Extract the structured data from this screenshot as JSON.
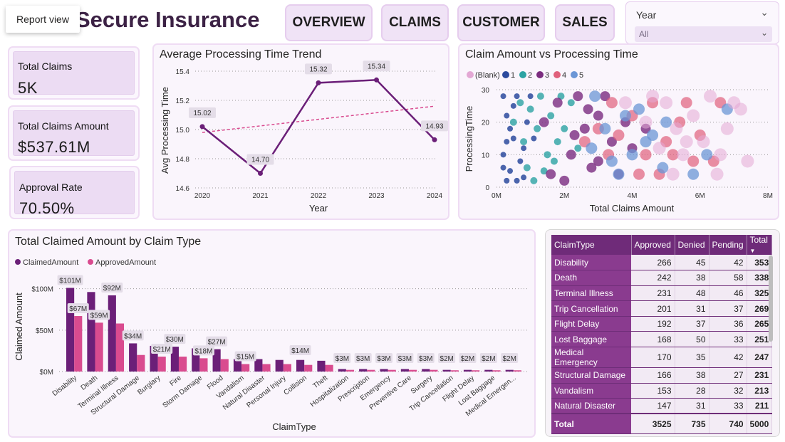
{
  "tooltip": "Report view",
  "title": "Secure Insurance",
  "nav": [
    "OVERVIEW",
    "CLAIMS",
    "CUSTOMER",
    "SALES"
  ],
  "slicer": {
    "label": "Year",
    "value": "All"
  },
  "kpis": [
    {
      "label": "Total Claims",
      "value": "5K"
    },
    {
      "label": "Total Claims Amount",
      "value": "$537.61M"
    },
    {
      "label": "Approval Rate",
      "value": "70.50%"
    }
  ],
  "colors": {
    "purple": "#6b1f78",
    "pink": "#d94b8f",
    "trend": "#d94b8f"
  },
  "line_chart": {
    "title": "Average Processing Time Trend",
    "xlabel": "Year",
    "ylabel": "Avg Processing Time",
    "chart_data": {
      "type": "line",
      "x": [
        "2020",
        "2021",
        "2022",
        "2023",
        "2024"
      ],
      "values": [
        15.02,
        14.7,
        15.32,
        15.34,
        14.93
      ],
      "labels": [
        "15.02",
        "14.70",
        "15.32",
        "15.34",
        "14.93"
      ],
      "ylim": [
        14.6,
        15.4
      ],
      "yticks": [
        "15.4",
        "15.2",
        "15.0",
        "14.8",
        "14.6"
      ],
      "trendline": [
        14.98,
        15.16
      ]
    }
  },
  "scatter_chart": {
    "title": "Claim Amount vs Processing Time",
    "xlabel": "Total Claims Amount",
    "ylabel": "ProcessingTime",
    "legend": [
      {
        "name": "(Blank)",
        "color": "#e3a8d4"
      },
      {
        "name": "1",
        "color": "#2c4a9e"
      },
      {
        "name": "2",
        "color": "#2ca3a3"
      },
      {
        "name": "3",
        "color": "#7b2c7f"
      },
      {
        "name": "4",
        "color": "#e0607c"
      },
      {
        "name": "5",
        "color": "#6b96d6"
      }
    ],
    "xticks": [
      "0M",
      "2M",
      "4M",
      "6M",
      "8M"
    ],
    "yticks": [
      "30",
      "20",
      "10",
      "0"
    ],
    "chart_data": {
      "type": "scatter",
      "xlim": [
        0,
        8
      ],
      "ylim": [
        0,
        30
      ],
      "points": [
        [
          0.2,
          28,
          1
        ],
        [
          0.3,
          22,
          1
        ],
        [
          0.2,
          10,
          1
        ],
        [
          0.4,
          5,
          1
        ],
        [
          0.5,
          15,
          1
        ],
        [
          0.6,
          28,
          1
        ],
        [
          0.4,
          18,
          1
        ],
        [
          0.3,
          2,
          1
        ],
        [
          0.8,
          12,
          1
        ],
        [
          0.5,
          25,
          1
        ],
        [
          0.7,
          8,
          1
        ],
        [
          0.9,
          20,
          1
        ],
        [
          0.3,
          14,
          1
        ],
        [
          0.6,
          2,
          1
        ],
        [
          1.0,
          28,
          1
        ],
        [
          0.2,
          6,
          1
        ],
        [
          1.1,
          15,
          1
        ],
        [
          0.8,
          3,
          1
        ],
        [
          0.5,
          20,
          2
        ],
        [
          0.8,
          14,
          2
        ],
        [
          1.0,
          24,
          2
        ],
        [
          1.2,
          18,
          2
        ],
        [
          1.5,
          10,
          2
        ],
        [
          0.9,
          6,
          2
        ],
        [
          1.3,
          28,
          2
        ],
        [
          1.6,
          22,
          2
        ],
        [
          1.8,
          14,
          2
        ],
        [
          0.7,
          26,
          2
        ],
        [
          2.0,
          18,
          2
        ],
        [
          1.4,
          5,
          2
        ],
        [
          2.2,
          26,
          2
        ],
        [
          1.1,
          2,
          2
        ],
        [
          1.7,
          8,
          2
        ],
        [
          2.4,
          12,
          2
        ],
        [
          1.9,
          28,
          2
        ],
        [
          1.4,
          20,
          3
        ],
        [
          1.8,
          26,
          3
        ],
        [
          2.2,
          10,
          3
        ],
        [
          2.6,
          18,
          3
        ],
        [
          3.0,
          22,
          3
        ],
        [
          2.8,
          6,
          3
        ],
        [
          3.4,
          14,
          3
        ],
        [
          2.4,
          28,
          3
        ],
        [
          1.6,
          4,
          3
        ],
        [
          3.2,
          28,
          3
        ],
        [
          3.6,
          4,
          3
        ],
        [
          2.0,
          2,
          3
        ],
        [
          3.0,
          8,
          3
        ],
        [
          2.7,
          24,
          3
        ],
        [
          4.0,
          12,
          3
        ],
        [
          3.8,
          20,
          3
        ],
        [
          4.4,
          18,
          3
        ],
        [
          2.3,
          16,
          3
        ],
        [
          2.6,
          14,
          4
        ],
        [
          3.0,
          18,
          4
        ],
        [
          3.4,
          26,
          4
        ],
        [
          3.6,
          16,
          4
        ],
        [
          4.0,
          22,
          4
        ],
        [
          4.4,
          10,
          4
        ],
        [
          4.6,
          26,
          4
        ],
        [
          5.0,
          14,
          4
        ],
        [
          5.4,
          20,
          4
        ],
        [
          5.8,
          8,
          4
        ],
        [
          6.0,
          16,
          4
        ],
        [
          4.2,
          4,
          4
        ],
        [
          4.8,
          4,
          4
        ],
        [
          5.6,
          26,
          4
        ],
        [
          6.4,
          8,
          4
        ],
        [
          6.6,
          26,
          4
        ],
        [
          3.3,
          10,
          4
        ],
        [
          5.2,
          10,
          4
        ],
        [
          2.8,
          12,
          5
        ],
        [
          3.2,
          18,
          5
        ],
        [
          3.6,
          4,
          5
        ],
        [
          3.8,
          22,
          5
        ],
        [
          4.0,
          10,
          5
        ],
        [
          4.2,
          24,
          5
        ],
        [
          4.6,
          16,
          5
        ],
        [
          4.9,
          6,
          5
        ],
        [
          5.0,
          20,
          5
        ],
        [
          6.2,
          10,
          5
        ],
        [
          6.8,
          24,
          5
        ],
        [
          3.4,
          8,
          5
        ],
        [
          4.4,
          14,
          5
        ],
        [
          2.9,
          28,
          5
        ],
        [
          5.8,
          4,
          5
        ],
        [
          3.8,
          26,
          0
        ],
        [
          4.4,
          20,
          0
        ],
        [
          4.8,
          12,
          0
        ],
        [
          5.0,
          26,
          0
        ],
        [
          5.3,
          18,
          0
        ],
        [
          5.5,
          10,
          0
        ],
        [
          5.8,
          22,
          0
        ],
        [
          6.1,
          14,
          0
        ],
        [
          6.5,
          4,
          0
        ],
        [
          6.8,
          18,
          0
        ],
        [
          7.0,
          26,
          0
        ],
        [
          7.4,
          8,
          0
        ],
        [
          5.2,
          4,
          0
        ],
        [
          6.3,
          28,
          0
        ],
        [
          4.6,
          28,
          0
        ],
        [
          5.6,
          14,
          0
        ],
        [
          6.6,
          10,
          0
        ],
        [
          7.2,
          24,
          0
        ]
      ]
    }
  },
  "bar_chart": {
    "title": "Total Claimed Amount by Claim Type",
    "xlabel": "ClaimType",
    "ylabel": "Claimed Amount",
    "legend": [
      "ClaimedAmount",
      "ApprovedAmount"
    ],
    "yticks": [
      "$100M",
      "$50M",
      "$0M"
    ],
    "chart_data": {
      "type": "bar",
      "ylim": [
        0,
        110
      ],
      "categories": [
        "Disability",
        "Death",
        "Terminal Illness",
        "Structural Damage",
        "Burglary",
        "Fire",
        "Storm Damage",
        "Flood",
        "Vandalism",
        "Natural Disaster",
        "Personal Injury",
        "Collision",
        "Theft",
        "Hospitalization",
        "Prescription",
        "Emergency",
        "Preventive Care",
        "Surgery",
        "Trip Cancellation",
        "Flight Delay",
        "Lost Baggage",
        "Medical Emergen..."
      ],
      "series": [
        {
          "name": "ClaimedAmount",
          "values": [
            101,
            96,
            92,
            34,
            31,
            30,
            28,
            27,
            15,
            15,
            14,
            14,
            13,
            3,
            3,
            3,
            3,
            3,
            2,
            2,
            2,
            2
          ]
        },
        {
          "name": "ApprovedAmount",
          "values": [
            67,
            59,
            58,
            20,
            18,
            18,
            16,
            15,
            9,
            9,
            9,
            8,
            8,
            2,
            2,
            2,
            2,
            2,
            1.5,
            1.5,
            1.5,
            1.5
          ]
        }
      ],
      "data_labels": [
        "$101M",
        "$67M",
        "$92M",
        "$59M",
        "$34M",
        "$21M",
        "$30M",
        "$18M",
        "$27M",
        "$15M",
        "$14M",
        "$3M",
        "$3M",
        "$3M",
        "$3M",
        "$3M",
        "$2M",
        "$2M",
        "$2M",
        "$2M"
      ]
    }
  },
  "table": {
    "headers": [
      "ClaimType",
      "Approved",
      "Denied",
      "Pending",
      "Total"
    ],
    "rows": [
      [
        "Disability",
        "266",
        "45",
        "42",
        "353"
      ],
      [
        "Death",
        "242",
        "38",
        "58",
        "338"
      ],
      [
        "Terminal Illness",
        "231",
        "48",
        "46",
        "325"
      ],
      [
        "Trip Cancellation",
        "201",
        "31",
        "37",
        "269"
      ],
      [
        "Flight Delay",
        "192",
        "37",
        "36",
        "265"
      ],
      [
        "Lost Baggage",
        "168",
        "50",
        "33",
        "251"
      ],
      [
        "Medical Emergency",
        "170",
        "35",
        "42",
        "247"
      ],
      [
        "Structural Damage",
        "166",
        "38",
        "27",
        "231"
      ],
      [
        "Vandalism",
        "153",
        "28",
        "32",
        "213"
      ],
      [
        "Natural Disaster",
        "147",
        "31",
        "33",
        "211"
      ]
    ],
    "total": [
      "Total",
      "3525",
      "735",
      "740",
      "5000"
    ]
  }
}
